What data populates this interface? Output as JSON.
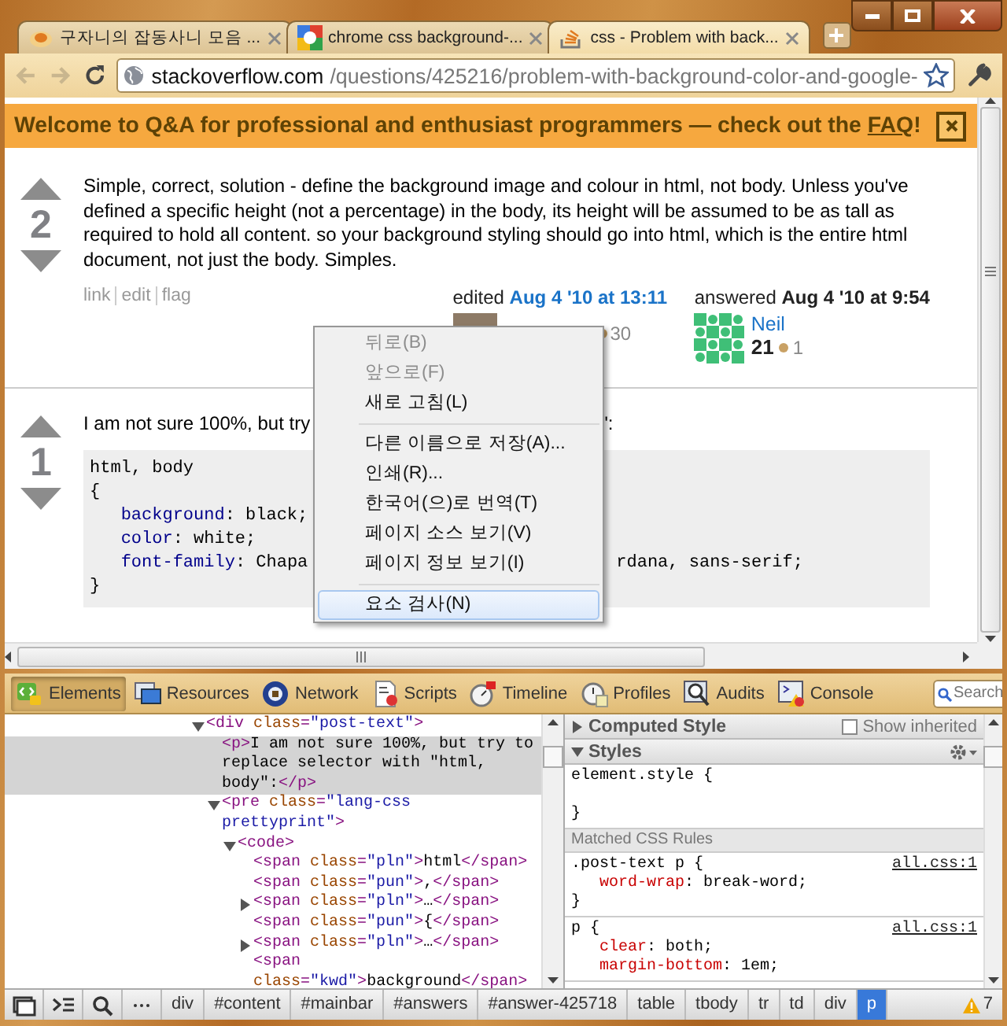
{
  "window": {
    "tabs": [
      {
        "title": "구자니의 잡동사니 모음 ...",
        "selected": false
      },
      {
        "title": "chrome css background-...",
        "selected": false
      },
      {
        "title": "css - Problem with back...",
        "selected": true
      }
    ]
  },
  "toolbar": {
    "back": {
      "disabled": true
    },
    "forward": {
      "disabled": true
    },
    "address": {
      "host": "stackoverflow.com",
      "path": "/questions/425216/problem-with-background-color-and-google-"
    }
  },
  "banner": {
    "text": "Welcome to Q&A for professional and enthusiast programmers — check out the ",
    "link": "FAQ",
    "after": "!"
  },
  "answers": [
    {
      "votes": "2",
      "body": "Simple, correct, solution - define the background image and colour in html, not body. Unless you've defined a specific height (not a percentage) in the body, its height will be assumed to be as tall as required to hold all content. so your background styling should go into html, which is the entire html document, not just the body. Simples.",
      "actions": [
        "link",
        "edit",
        "flag"
      ],
      "edited": {
        "label": "edited",
        "time": "Aug 4 '10 at 13:11",
        "rep": "30"
      },
      "answered": {
        "label": "answered",
        "time": "Aug 4 '10 at 9:54",
        "user": "Neil",
        "rep": "21",
        "bronze": "1"
      }
    },
    {
      "votes": "1",
      "body_start": "I am not sure 100%, but try",
      "body_end": "\":",
      "code": [
        {
          "text": "html, body"
        },
        {
          "text": "{"
        },
        {
          "text": "   background: black;"
        },
        {
          "text": "   color: white;"
        },
        {
          "text": "   font-family: Chapa",
          "after": "rdana, sans-serif;"
        },
        {
          "text": "}"
        }
      ]
    }
  ],
  "context_menu": {
    "items": [
      {
        "kind": "item",
        "label": "뒤로(B)",
        "disabled": true,
        "selected": false
      },
      {
        "kind": "item",
        "label": "앞으로(F)",
        "disabled": true,
        "selected": false
      },
      {
        "kind": "item",
        "label": "새로 고침(L)",
        "disabled": false,
        "selected": false
      },
      {
        "kind": "separator"
      },
      {
        "kind": "item",
        "label": "다른 이름으로 저장(A)...",
        "disabled": false,
        "selected": false
      },
      {
        "kind": "item",
        "label": "인쇄(R)...",
        "disabled": false,
        "selected": false
      },
      {
        "kind": "item",
        "label": "한국어(으)로 번역(T)",
        "disabled": false,
        "selected": false
      },
      {
        "kind": "item",
        "label": "페이지 소스 보기(V)",
        "disabled": false,
        "selected": false
      },
      {
        "kind": "item",
        "label": "페이지 정보 보기(I)",
        "disabled": false,
        "selected": false
      },
      {
        "kind": "separator"
      },
      {
        "kind": "item",
        "label": "요소 검사(N)",
        "disabled": false,
        "selected": true
      }
    ]
  },
  "devtools": {
    "tabs": [
      {
        "label": "Elements",
        "selected": true
      },
      {
        "label": "Resources",
        "selected": false
      },
      {
        "label": "Network",
        "selected": false
      },
      {
        "label": "Scripts",
        "selected": false
      },
      {
        "label": "Timeline",
        "selected": false
      },
      {
        "label": "Profiles",
        "selected": false
      },
      {
        "label": "Audits",
        "selected": false
      },
      {
        "label": "Console",
        "selected": false
      }
    ],
    "search": {
      "placeholder": "Search"
    },
    "dom": [
      {
        "kind": "parent",
        "text": "<div class=\"post-text\">",
        "expanded": true,
        "selected": false,
        "children": [
          {
            "kind": "leaf",
            "text": "<p>I am not sure 100%, but try to replace selector with \"html, body\":</p>",
            "selected": true
          },
          {
            "kind": "parent",
            "text": "<pre class=\"lang-css prettyprint\">",
            "expanded": true,
            "selected": false,
            "children": [
              {
                "kind": "parent",
                "text": "<code>",
                "expanded": true,
                "selected": false,
                "children": [
                  {
                    "kind": "leaf",
                    "text": "<span class=\"pln\">html</span>",
                    "selected": false
                  },
                  {
                    "kind": "leaf",
                    "text": "<span class=\"pun\">,</span>",
                    "selected": false
                  },
                  {
                    "kind": "parent",
                    "text": "<span class=\"pln\">…</span>",
                    "expanded": false,
                    "selected": false
                  },
                  {
                    "kind": "leaf",
                    "text": "<span class=\"pun\">{</span>",
                    "selected": false
                  },
                  {
                    "kind": "parent",
                    "text": "<span class=\"pln\">…</span>",
                    "expanded": false,
                    "selected": false
                  },
                  {
                    "kind": "leaf",
                    "text": "<span class=\"kwd\">background</span>",
                    "selected": false
                  }
                ]
              }
            ]
          }
        ]
      }
    ],
    "styles": {
      "computed": {
        "title": "Computed Style",
        "expanded": false,
        "show_inherited": {
          "label": "Show inherited",
          "checked": false
        }
      },
      "section": {
        "title": "Styles",
        "expanded": true
      },
      "element_style": {
        "open": "element.style {",
        "close": "}"
      },
      "matched_title": "Matched CSS Rules",
      "rules": [
        {
          "open": ".post-text p {",
          "source": "all.css:1",
          "properties": [
            {
              "name": "word-wrap",
              "rest": ": break-word;"
            }
          ],
          "close": "}"
        },
        {
          "open": "p {",
          "source": "all.css:1",
          "properties": [
            {
              "name": "clear",
              "rest": ": both;"
            },
            {
              "name": "margin-bottom",
              "rest": ": 1em;"
            }
          ]
        }
      ]
    },
    "breadcrumbs": {
      "items": [
        {
          "label": "div",
          "selected": false
        },
        {
          "label": "#content",
          "selected": false
        },
        {
          "label": "#mainbar",
          "selected": false
        },
        {
          "label": "#answers",
          "selected": false
        },
        {
          "label": "#answer-425718",
          "selected": false
        },
        {
          "label": "table",
          "selected": false
        },
        {
          "label": "tbody",
          "selected": false
        },
        {
          "label": "tr",
          "selected": false
        },
        {
          "label": "td",
          "selected": false
        },
        {
          "label": "div",
          "selected": false
        },
        {
          "label": "p",
          "selected": true
        }
      ],
      "warnings": "7"
    }
  }
}
